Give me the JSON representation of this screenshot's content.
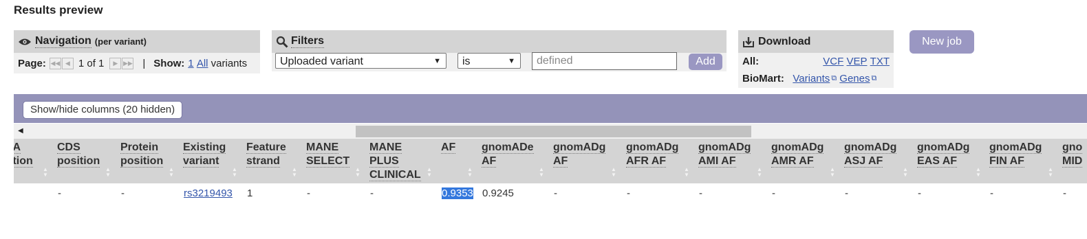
{
  "page_title": "Results preview",
  "navigation": {
    "title": "Navigation",
    "subtitle": "(per variant)",
    "page_label": "Page:",
    "page_text": "1 of 1",
    "separator": "|",
    "show_label": "Show:",
    "show_1": "1",
    "show_all": "All",
    "show_suffix": "variants"
  },
  "filters": {
    "title": "Filters",
    "field_selected": "Uploaded variant",
    "operator_selected": "is",
    "value_placeholder": "defined",
    "add_label": "Add"
  },
  "download": {
    "title": "Download",
    "all_label": "All:",
    "vcf": "VCF",
    "vep": "VEP",
    "txt": "TXT",
    "biomart_label": "BioMart:",
    "variants": "Variants",
    "genes": "Genes"
  },
  "new_job_label": "New job",
  "show_hide_label": "Show/hide columns (20 hidden)",
  "columns": [
    {
      "l1": "IA",
      "l2": "ition",
      "l3": ""
    },
    {
      "l1": "CDS",
      "l2": "position",
      "l3": ""
    },
    {
      "l1": "Protein",
      "l2": "position",
      "l3": ""
    },
    {
      "l1": "Existing",
      "l2": "variant",
      "l3": ""
    },
    {
      "l1": "Feature",
      "l2": "strand",
      "l3": ""
    },
    {
      "l1": "MANE",
      "l2": "SELECT",
      "l3": ""
    },
    {
      "l1": "MANE",
      "l2": "PLUS",
      "l3": "CLINICAL"
    },
    {
      "l1": "AF",
      "l2": "",
      "l3": ""
    },
    {
      "l1": "gnomADe",
      "l2": "AF",
      "l3": ""
    },
    {
      "l1": "gnomADg",
      "l2": "AF",
      "l3": ""
    },
    {
      "l1": "gnomADg",
      "l2": "AFR AF",
      "l3": ""
    },
    {
      "l1": "gnomADg",
      "l2": "AMI AF",
      "l3": ""
    },
    {
      "l1": "gnomADg",
      "l2": "AMR AF",
      "l3": ""
    },
    {
      "l1": "gnomADg",
      "l2": "ASJ AF",
      "l3": ""
    },
    {
      "l1": "gnomADg",
      "l2": "EAS AF",
      "l3": ""
    },
    {
      "l1": "gnomADg",
      "l2": "FIN AF",
      "l3": ""
    },
    {
      "l1": "gno",
      "l2": "MID",
      "l3": ""
    }
  ],
  "row": [
    "",
    "-",
    "-",
    "rs3219493",
    "1",
    "-",
    "-",
    "0.9353",
    "0.9245",
    "-",
    "-",
    "-",
    "-",
    "-",
    "-",
    "-",
    "-"
  ]
}
